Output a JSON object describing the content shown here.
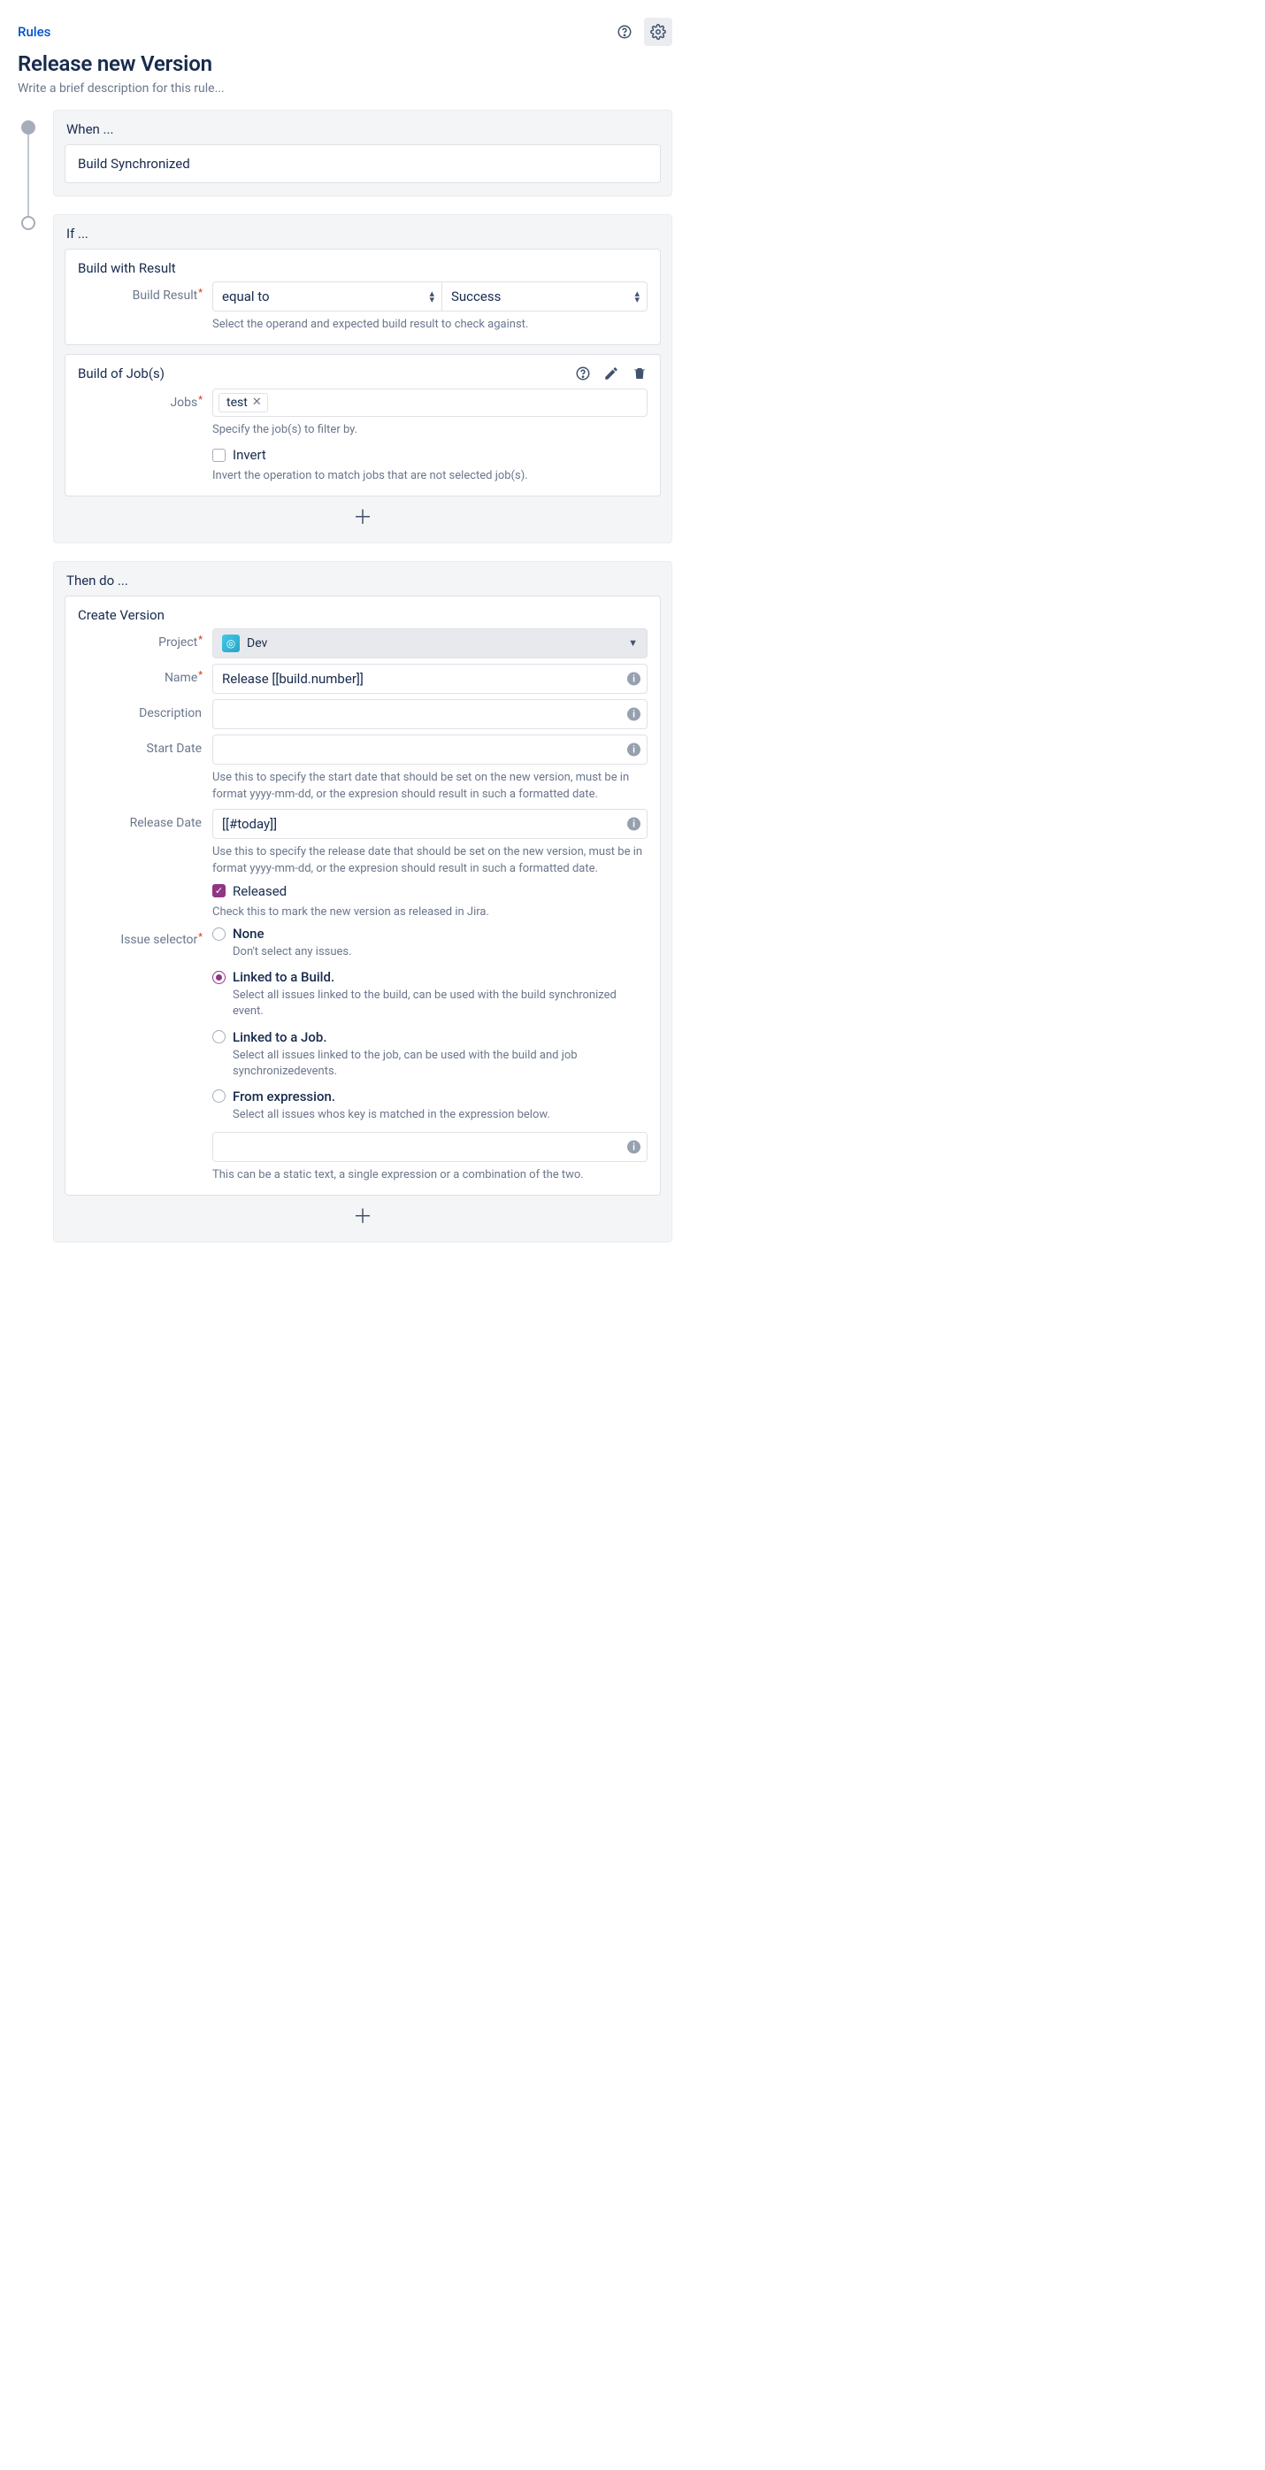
{
  "top": {
    "rules": "Rules"
  },
  "rule_title": "Release new Version",
  "rule_desc_placeholder": "Write a brief description for this rule...",
  "when": {
    "label": "When ...",
    "trigger": "Build Synchronized"
  },
  "if": {
    "label": "If ...",
    "build_result": {
      "title": "Build with Result",
      "label": "Build Result",
      "operand": "equal to",
      "value": "Success",
      "help": "Select the operand and expected build result to check against."
    },
    "build_jobs": {
      "title": "Build of Job(s)",
      "label": "Jobs",
      "token": "test",
      "help": "Specify the job(s) to filter by.",
      "invert_label": "Invert",
      "invert_help": "Invert the operation to match jobs that are not selected job(s)."
    }
  },
  "then": {
    "label": "Then do ...",
    "title": "Create Version",
    "project": {
      "label": "Project",
      "value": "Dev"
    },
    "name": {
      "label": "Name",
      "value": "Release [[build.number]]"
    },
    "description": {
      "label": "Description",
      "value": ""
    },
    "start_date": {
      "label": "Start Date",
      "value": "",
      "help": "Use this to specify the start date that should be set on the new version, must be in format yyyy-mm-dd, or the expresion should result in such a formatted date."
    },
    "release_date": {
      "label": "Release Date",
      "value": "[[#today]]",
      "help": "Use this to specify the release date that should be set on the new version, must be in format yyyy-mm-dd, or the expresion should result in such a formatted date."
    },
    "released": {
      "label": "Released",
      "help": "Check this to mark the new version as released in Jira."
    },
    "issue_selector": {
      "label": "Issue selector",
      "options": {
        "none": {
          "label": "None",
          "help": "Don't select any issues."
        },
        "build": {
          "label": "Linked to a Build.",
          "help": "Select all issues linked to the build, can be used with the build synchronized event."
        },
        "job": {
          "label": "Linked to a Job.",
          "help": "Select all issues linked to the job, can be used with the build and job synchronizedevents."
        },
        "expr": {
          "label": "From expression.",
          "help": "Select all issues whos key is matched in the expression below.",
          "footer": "This can be a static text, a single expression or a combination of the two."
        }
      }
    }
  }
}
